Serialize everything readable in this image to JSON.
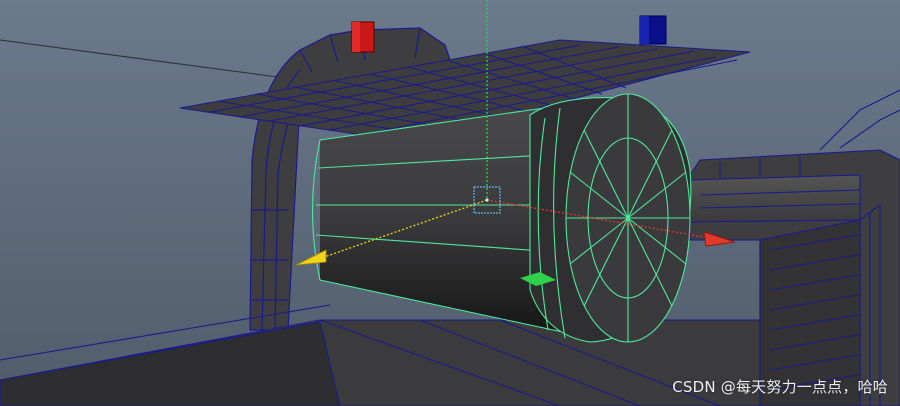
{
  "viewport": {
    "background_top": "#6b7a8c",
    "background_bottom": "#4f5c6b",
    "mesh_fill": "#3d3d3f",
    "wire_color": "#1b1a8c",
    "selected_wire_color": "#4fe89a",
    "axis_colors": {
      "x": "#e23a2a",
      "y": "#2ed14a",
      "z": "#f2d21a"
    }
  },
  "overlay": {
    "watermark": "CSDN @每天努力一点点，哈哈"
  },
  "icons": {
    "left_marker": "red-locator-icon",
    "right_marker": "blue-locator-icon",
    "pivot": "pivot-icon"
  }
}
